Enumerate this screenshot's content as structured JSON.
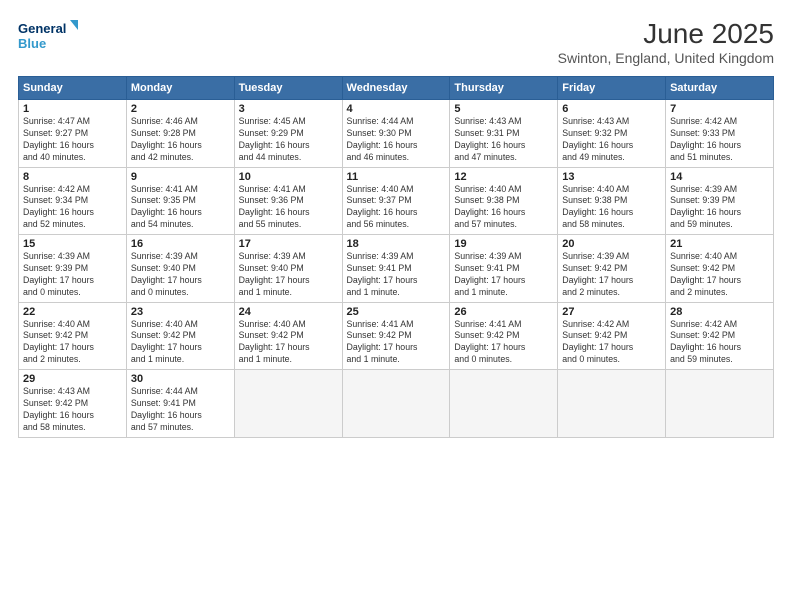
{
  "logo": {
    "line1": "General",
    "line2": "Blue"
  },
  "title": "June 2025",
  "subtitle": "Swinton, England, United Kingdom",
  "days_of_week": [
    "Sunday",
    "Monday",
    "Tuesday",
    "Wednesday",
    "Thursday",
    "Friday",
    "Saturday"
  ],
  "weeks": [
    [
      {
        "day": "1",
        "info": "Sunrise: 4:47 AM\nSunset: 9:27 PM\nDaylight: 16 hours\nand 40 minutes."
      },
      {
        "day": "2",
        "info": "Sunrise: 4:46 AM\nSunset: 9:28 PM\nDaylight: 16 hours\nand 42 minutes."
      },
      {
        "day": "3",
        "info": "Sunrise: 4:45 AM\nSunset: 9:29 PM\nDaylight: 16 hours\nand 44 minutes."
      },
      {
        "day": "4",
        "info": "Sunrise: 4:44 AM\nSunset: 9:30 PM\nDaylight: 16 hours\nand 46 minutes."
      },
      {
        "day": "5",
        "info": "Sunrise: 4:43 AM\nSunset: 9:31 PM\nDaylight: 16 hours\nand 47 minutes."
      },
      {
        "day": "6",
        "info": "Sunrise: 4:43 AM\nSunset: 9:32 PM\nDaylight: 16 hours\nand 49 minutes."
      },
      {
        "day": "7",
        "info": "Sunrise: 4:42 AM\nSunset: 9:33 PM\nDaylight: 16 hours\nand 51 minutes."
      }
    ],
    [
      {
        "day": "8",
        "info": "Sunrise: 4:42 AM\nSunset: 9:34 PM\nDaylight: 16 hours\nand 52 minutes."
      },
      {
        "day": "9",
        "info": "Sunrise: 4:41 AM\nSunset: 9:35 PM\nDaylight: 16 hours\nand 54 minutes."
      },
      {
        "day": "10",
        "info": "Sunrise: 4:41 AM\nSunset: 9:36 PM\nDaylight: 16 hours\nand 55 minutes."
      },
      {
        "day": "11",
        "info": "Sunrise: 4:40 AM\nSunset: 9:37 PM\nDaylight: 16 hours\nand 56 minutes."
      },
      {
        "day": "12",
        "info": "Sunrise: 4:40 AM\nSunset: 9:38 PM\nDaylight: 16 hours\nand 57 minutes."
      },
      {
        "day": "13",
        "info": "Sunrise: 4:40 AM\nSunset: 9:38 PM\nDaylight: 16 hours\nand 58 minutes."
      },
      {
        "day": "14",
        "info": "Sunrise: 4:39 AM\nSunset: 9:39 PM\nDaylight: 16 hours\nand 59 minutes."
      }
    ],
    [
      {
        "day": "15",
        "info": "Sunrise: 4:39 AM\nSunset: 9:39 PM\nDaylight: 17 hours\nand 0 minutes."
      },
      {
        "day": "16",
        "info": "Sunrise: 4:39 AM\nSunset: 9:40 PM\nDaylight: 17 hours\nand 0 minutes."
      },
      {
        "day": "17",
        "info": "Sunrise: 4:39 AM\nSunset: 9:40 PM\nDaylight: 17 hours\nand 1 minute."
      },
      {
        "day": "18",
        "info": "Sunrise: 4:39 AM\nSunset: 9:41 PM\nDaylight: 17 hours\nand 1 minute."
      },
      {
        "day": "19",
        "info": "Sunrise: 4:39 AM\nSunset: 9:41 PM\nDaylight: 17 hours\nand 1 minute."
      },
      {
        "day": "20",
        "info": "Sunrise: 4:39 AM\nSunset: 9:42 PM\nDaylight: 17 hours\nand 2 minutes."
      },
      {
        "day": "21",
        "info": "Sunrise: 4:40 AM\nSunset: 9:42 PM\nDaylight: 17 hours\nand 2 minutes."
      }
    ],
    [
      {
        "day": "22",
        "info": "Sunrise: 4:40 AM\nSunset: 9:42 PM\nDaylight: 17 hours\nand 2 minutes."
      },
      {
        "day": "23",
        "info": "Sunrise: 4:40 AM\nSunset: 9:42 PM\nDaylight: 17 hours\nand 1 minute."
      },
      {
        "day": "24",
        "info": "Sunrise: 4:40 AM\nSunset: 9:42 PM\nDaylight: 17 hours\nand 1 minute."
      },
      {
        "day": "25",
        "info": "Sunrise: 4:41 AM\nSunset: 9:42 PM\nDaylight: 17 hours\nand 1 minute."
      },
      {
        "day": "26",
        "info": "Sunrise: 4:41 AM\nSunset: 9:42 PM\nDaylight: 17 hours\nand 0 minutes."
      },
      {
        "day": "27",
        "info": "Sunrise: 4:42 AM\nSunset: 9:42 PM\nDaylight: 17 hours\nand 0 minutes."
      },
      {
        "day": "28",
        "info": "Sunrise: 4:42 AM\nSunset: 9:42 PM\nDaylight: 16 hours\nand 59 minutes."
      }
    ],
    [
      {
        "day": "29",
        "info": "Sunrise: 4:43 AM\nSunset: 9:42 PM\nDaylight: 16 hours\nand 58 minutes."
      },
      {
        "day": "30",
        "info": "Sunrise: 4:44 AM\nSunset: 9:41 PM\nDaylight: 16 hours\nand 57 minutes."
      },
      {
        "day": "",
        "info": ""
      },
      {
        "day": "",
        "info": ""
      },
      {
        "day": "",
        "info": ""
      },
      {
        "day": "",
        "info": ""
      },
      {
        "day": "",
        "info": ""
      }
    ]
  ]
}
